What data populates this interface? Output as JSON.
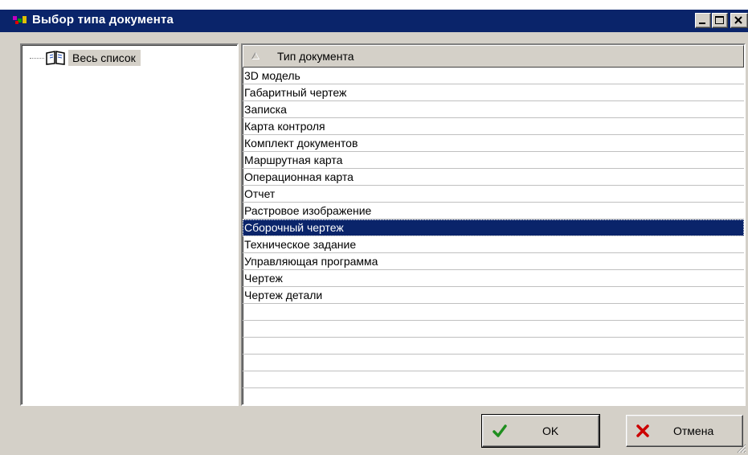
{
  "window": {
    "title": "Выбор типа документа"
  },
  "tree": {
    "root_label": "Весь список"
  },
  "list": {
    "column_header": "Тип документа",
    "rows": [
      "3D модель",
      "Габаритный чертеж",
      "Записка",
      "Карта контроля",
      "Комплект документов",
      "Маршрутная карта",
      "Операционная карта",
      "Отчет",
      "Растровое изображение",
      "Сборочный чертеж",
      "Техническое задание",
      "Управляющая программа",
      "Чертеж",
      "Чертеж детали"
    ],
    "selected_index": 9
  },
  "buttons": {
    "ok_label": "OK",
    "cancel_label": "Отмена"
  },
  "colors": {
    "selection": "#0a246a",
    "ok_check": "#1f8f1f",
    "cancel_x": "#cc0000"
  }
}
